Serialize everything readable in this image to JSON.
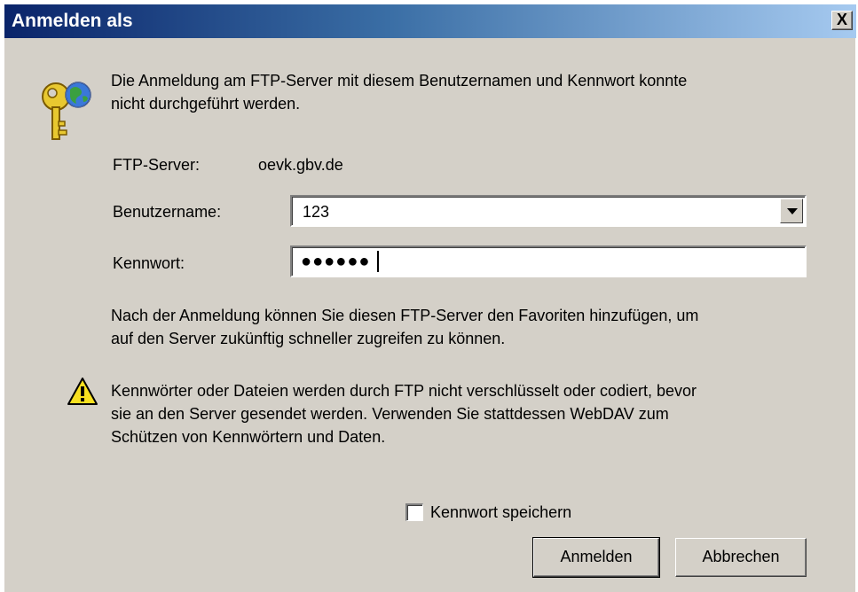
{
  "window": {
    "title": "Anmelden als",
    "close_label": "X"
  },
  "message": {
    "line1": "Die Anmeldung am FTP-Server mit diesem Benutzernamen und Kennwort konnte",
    "line2": "nicht durchgeführt werden."
  },
  "server": {
    "label": "FTP-Server:",
    "value": "oevk.gbv.de"
  },
  "username": {
    "label": "Benutzername:",
    "value": "123"
  },
  "password": {
    "label": "Kennwort:",
    "masked_value": "●●●●●●"
  },
  "info": {
    "line1": "Nach der Anmeldung können Sie diesen FTP-Server den Favoriten hinzufügen, um",
    "line2": "auf den Server zukünftig schneller zugreifen zu können."
  },
  "warning": {
    "line1": "Kennwörter oder Dateien werden durch FTP nicht verschlüsselt oder codiert, bevor",
    "line2": "sie an den Server gesendet werden. Verwenden Sie stattdessen WebDAV zum",
    "line3": "Schützen von Kennwörtern und Daten."
  },
  "save_password": {
    "label": "Kennwort speichern",
    "checked": false
  },
  "buttons": {
    "login": "Anmelden",
    "cancel": "Abbrechen"
  },
  "icons": {
    "key": "key-globe-icon",
    "warning": "warning-icon",
    "dropdown": "chevron-down-icon"
  }
}
